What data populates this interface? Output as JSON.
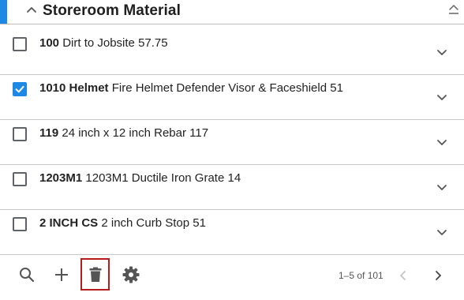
{
  "panel": {
    "title": "Storeroom Material",
    "accent_color": "#1e88e5"
  },
  "rows": [
    {
      "code": "100",
      "description": "Dirt to Jobsite 57.75",
      "checked": false
    },
    {
      "code": "1010 Helmet",
      "description": "Fire Helmet Defender Visor & Faceshield 51",
      "checked": true
    },
    {
      "code": "119",
      "description": "24 inch x 12 inch Rebar 117",
      "checked": false
    },
    {
      "code": "1203M1",
      "description": "1203M1 Ductile Iron Grate 14",
      "checked": false
    },
    {
      "code": "2 INCH CS",
      "description": "2 inch Curb Stop 51",
      "checked": false
    }
  ],
  "toolbar": {
    "icons": [
      "search-icon",
      "add-icon",
      "delete-icon",
      "settings-icon"
    ],
    "highlight_color": "#b51c1c"
  },
  "pagination": {
    "label": "1–5 of 101",
    "prev_enabled": false,
    "next_enabled": true
  },
  "icons": {
    "collapse": "chevron-up-icon",
    "sort": "sort-icon",
    "row_expand": "chevron-down-icon",
    "prev": "chevron-left-icon",
    "next": "chevron-right-icon"
  }
}
